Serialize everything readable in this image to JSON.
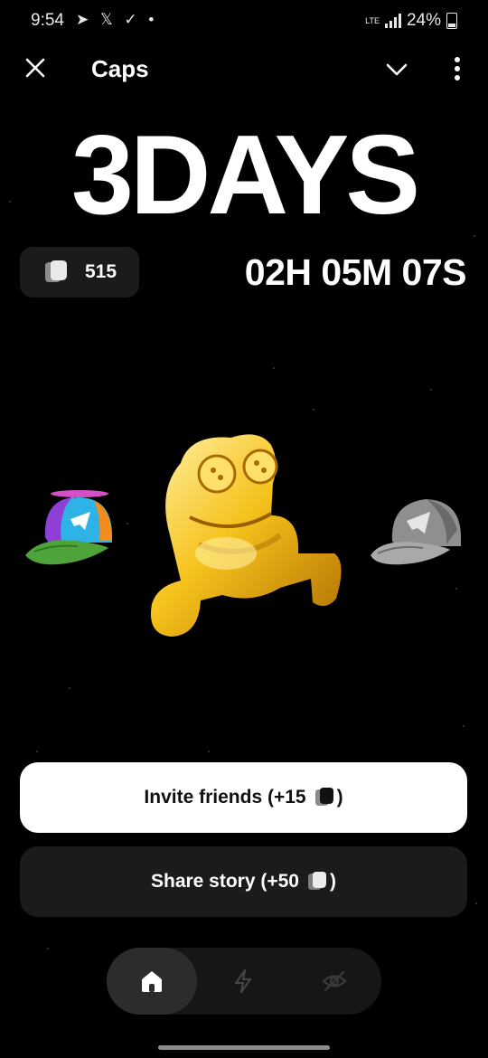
{
  "status_bar": {
    "time": "9:54",
    "notification_icons": "➤ 𝕏 ✓ •",
    "network": "LTE",
    "battery": "24%"
  },
  "header": {
    "title": "Caps",
    "icons": [
      "close-icon",
      "chevron-down-icon",
      "more-vertical-icon"
    ]
  },
  "countdown": {
    "days_label": "3DAYS",
    "time_left": "02H 05M 07S"
  },
  "balance": {
    "value": "515",
    "icon": "coin-icon"
  },
  "artwork": {
    "items": [
      "propeller-cap",
      "golden-frog-figure",
      "grey-cap"
    ]
  },
  "actions": {
    "invite_label": "Invite friends (+15",
    "invite_suffix": ")",
    "share_label": "Share story (+50",
    "share_suffix": ")"
  },
  "nav": {
    "items": [
      {
        "id": "home",
        "icon": "home-icon",
        "active": true
      },
      {
        "id": "boost",
        "icon": "lightning-icon",
        "active": false
      },
      {
        "id": "hidden",
        "icon": "eye-off-icon",
        "active": false
      }
    ]
  },
  "colors": {
    "background": "#000000",
    "card": "#1b1b1b",
    "primary_button": "#ffffff",
    "gold": "#f2b705"
  }
}
